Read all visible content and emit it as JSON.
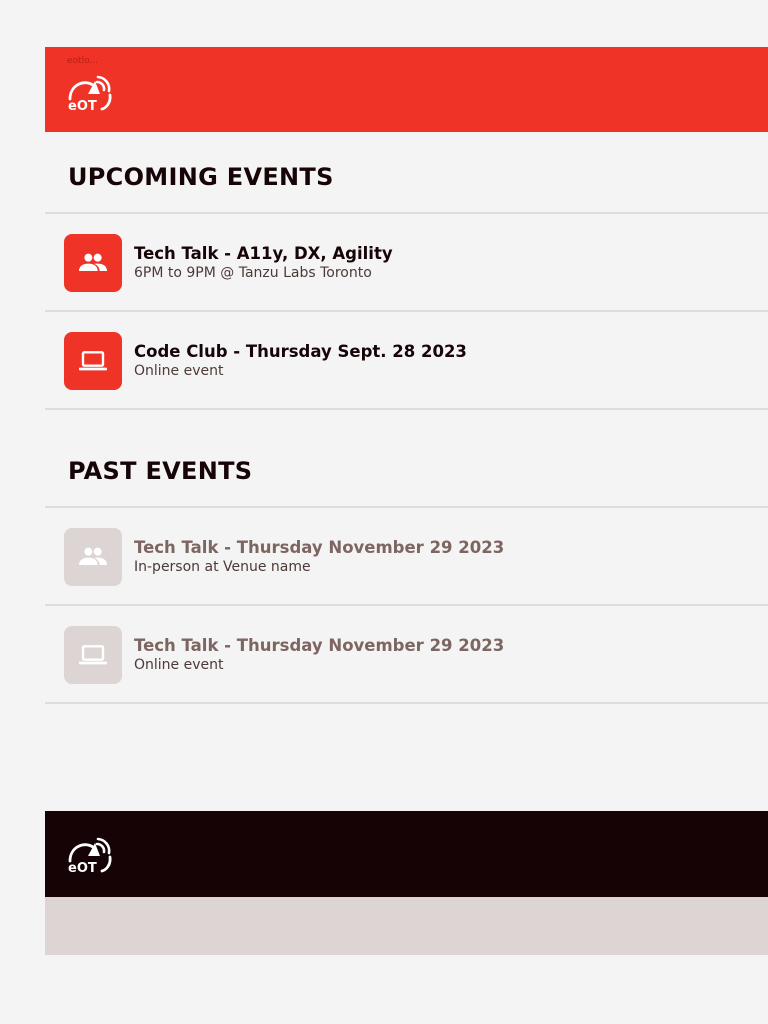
{
  "header": {
    "logo_alt": "eotlo...",
    "logo_text": "eOT"
  },
  "upcoming": {
    "heading": "UPCOMING EVENTS",
    "events": [
      {
        "title": "Tech Talk - A11y, DX, Agility",
        "subtitle": "6PM to 9PM @ Tanzu Labs Toronto",
        "icon": "people-icon"
      },
      {
        "title": "Code Club - Thursday Sept. 28 2023",
        "subtitle": "Online event",
        "icon": "laptop-icon"
      }
    ]
  },
  "past": {
    "heading": "PAST EVENTS",
    "events": [
      {
        "title": "Tech Talk - Thursday November 29 2023",
        "subtitle": "In-person at Venue name",
        "icon": "people-icon"
      },
      {
        "title": "Tech Talk - Thursday November 29 2023",
        "subtitle": "Online event",
        "icon": "laptop-icon"
      }
    ]
  },
  "footer": {
    "logo_text": "eOT"
  },
  "colors": {
    "brand_red": "#ef3327",
    "dark": "#150305",
    "muted_tile": "#ddd5d3",
    "muted_text": "#7d6661",
    "page_bg": "#f4f4f4"
  }
}
